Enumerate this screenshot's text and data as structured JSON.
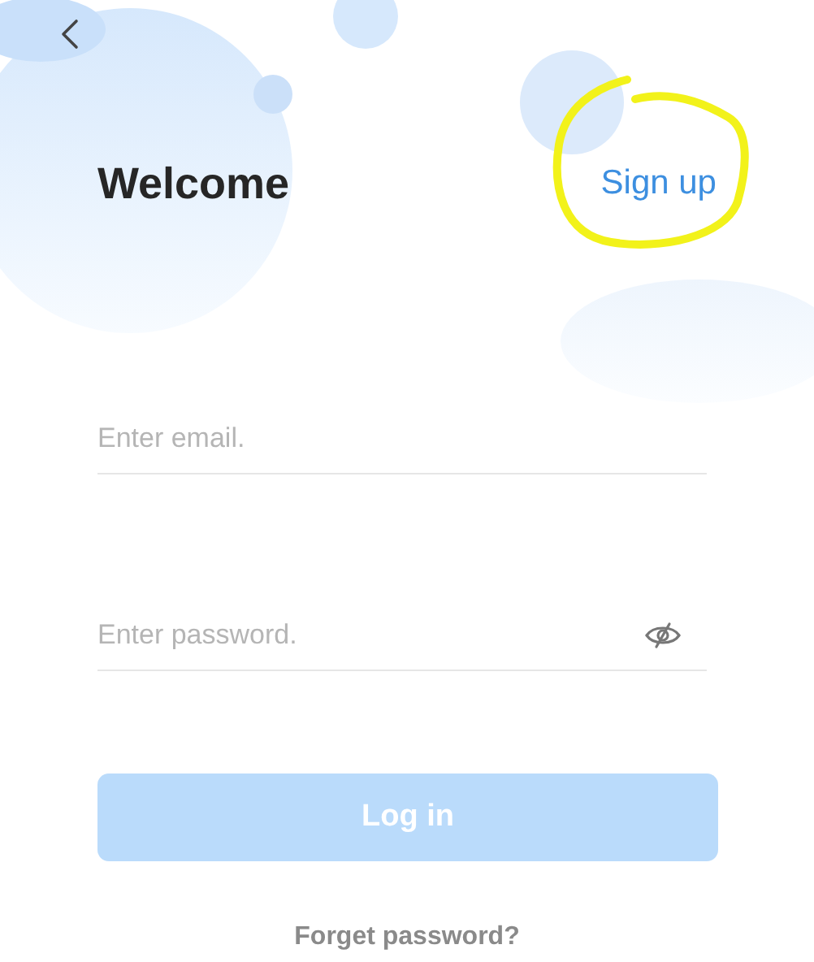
{
  "header": {
    "title": "Welcome",
    "sign_up": {
      "label": "Sign up",
      "highlighted": true
    }
  },
  "fields": [
    {
      "kind": "email",
      "placeholder": "Enter email."
    },
    {
      "kind": "password",
      "placeholder": "Enter password.",
      "password_visible": false
    }
  ],
  "login_button": {
    "label": "Log in",
    "disabled": true
  },
  "forgot_link": {
    "label": "Forget password?"
  }
}
